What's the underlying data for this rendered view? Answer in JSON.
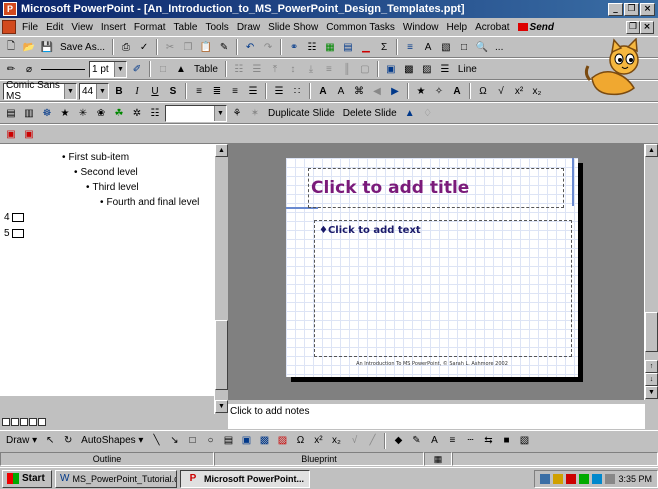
{
  "window": {
    "title": "Microsoft PowerPoint - [An_Introduction_to_MS_PowerPoint_Design_Templates.ppt]",
    "app_icon": "powerpoint-icon",
    "controls": [
      "_",
      "×",
      "×"
    ]
  },
  "menu": {
    "items": [
      "File",
      "Edit",
      "View",
      "Insert",
      "Format",
      "Table",
      "Tools",
      "Draw",
      "Slide Show",
      "Common Tasks",
      "Window",
      "Help",
      "Acrobat"
    ],
    "send": "Send"
  },
  "toolbar1": {
    "save_as": "Save As...",
    "ellipsis": "..."
  },
  "toolbar2": {
    "line_weight": "1 pt",
    "table_label": "Table",
    "line_label": "Line"
  },
  "toolbar3": {
    "font": "Comic Sans MS",
    "size": "44",
    "bold": "B",
    "italic": "I",
    "underline": "U",
    "shadow": "S"
  },
  "toolbar4": {
    "duplicate_slide": "Duplicate Slide",
    "delete_slide": "Delete Slide"
  },
  "outline": {
    "bullets": [
      "First sub-item",
      "Second level",
      "Third level",
      "Fourth and final level"
    ],
    "slide_numbers": [
      "4",
      "5"
    ]
  },
  "slide": {
    "title_placeholder": "Click to add title",
    "body_placeholder": "Click to add text",
    "footer": "An Introduction To MS PowerPoint, © Sarah L. Ashmore 2002"
  },
  "notes": {
    "placeholder": "Click to add notes"
  },
  "draw_toolbar": {
    "draw": "Draw",
    "autoshapes": "AutoShapes"
  },
  "status": {
    "view": "Outline",
    "template": "Blueprint"
  },
  "taskbar": {
    "start": "Start",
    "tasks": [
      "MS_PowerPoint_Tutorial.d...",
      "Microsoft PowerPoint..."
    ],
    "clock": "3:35 PM"
  },
  "colors": {
    "title_bar": "#0a246a",
    "slide_title": "#7a1a7a",
    "slide_text": "#1a1a6a",
    "slide_grid": "#dde4f5",
    "canvas": "#808080"
  }
}
